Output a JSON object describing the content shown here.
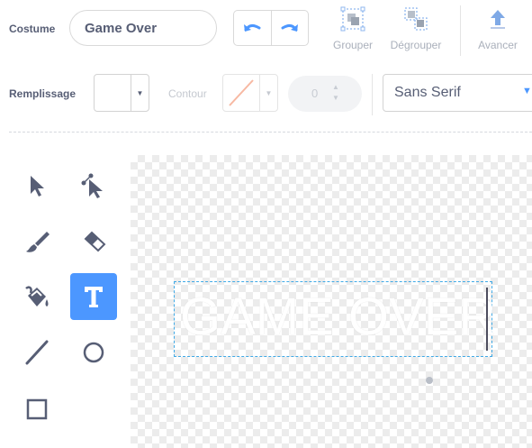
{
  "costume": {
    "label": "Costume",
    "name_value": "Game Over"
  },
  "toolbar": {
    "group_label": "Grouper",
    "ungroup_label": "Dégrouper",
    "forward_label": "Avancer"
  },
  "fill": {
    "label": "Remplissage",
    "color": "#ffffff"
  },
  "outline": {
    "label": "Contour",
    "width_value": "0"
  },
  "font": {
    "selected": "Sans Serif"
  },
  "canvas": {
    "text": "GAME OVER"
  },
  "colors": {
    "accent": "#4c97ff",
    "selection": "#3fa9e6",
    "icon": "#575e75"
  },
  "tools": [
    {
      "icon": "select-icon"
    },
    {
      "icon": "reshape-icon"
    },
    {
      "icon": "brush-icon"
    },
    {
      "icon": "eraser-icon"
    },
    {
      "icon": "fill-icon"
    },
    {
      "icon": "text-icon",
      "active": true
    },
    {
      "icon": "line-icon"
    },
    {
      "icon": "circle-icon"
    },
    {
      "icon": "rectangle-icon"
    }
  ]
}
